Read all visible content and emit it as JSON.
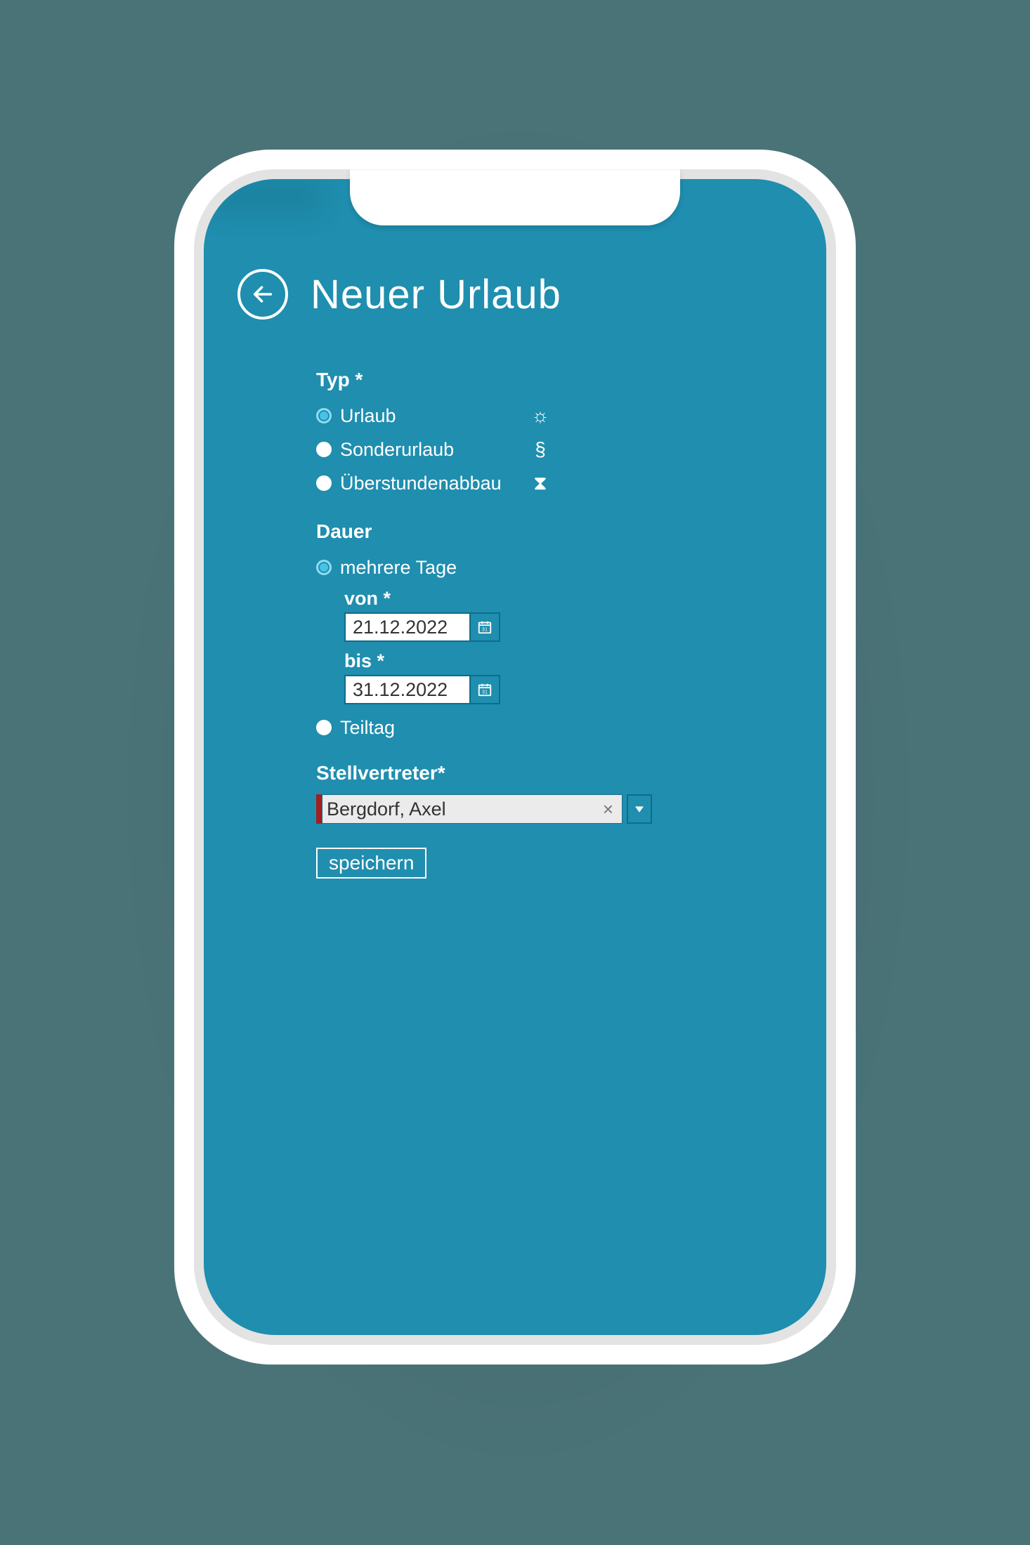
{
  "header": {
    "title": "Neuer Urlaub"
  },
  "type_section": {
    "label": "Typ *",
    "options": {
      "urlaub": {
        "label": "Urlaub",
        "icon": "☼",
        "selected": true
      },
      "sonder": {
        "label": "Sonderurlaub",
        "icon": "§",
        "selected": false
      },
      "ueberstd": {
        "label": "Überstundenabbau",
        "icon": "⧗",
        "selected": false
      }
    }
  },
  "duration_section": {
    "label": "Dauer",
    "multi": {
      "label": "mehrere Tage",
      "selected": true,
      "from_label": "von *",
      "from_value": "21.12.2022",
      "to_label": "bis *",
      "to_value": "31.12.2022"
    },
    "partial": {
      "label": "Teiltag",
      "selected": false
    }
  },
  "deputy_section": {
    "label": "Stellvertreter*",
    "value": "Bergdorf, Axel"
  },
  "actions": {
    "save_label": "speichern"
  }
}
